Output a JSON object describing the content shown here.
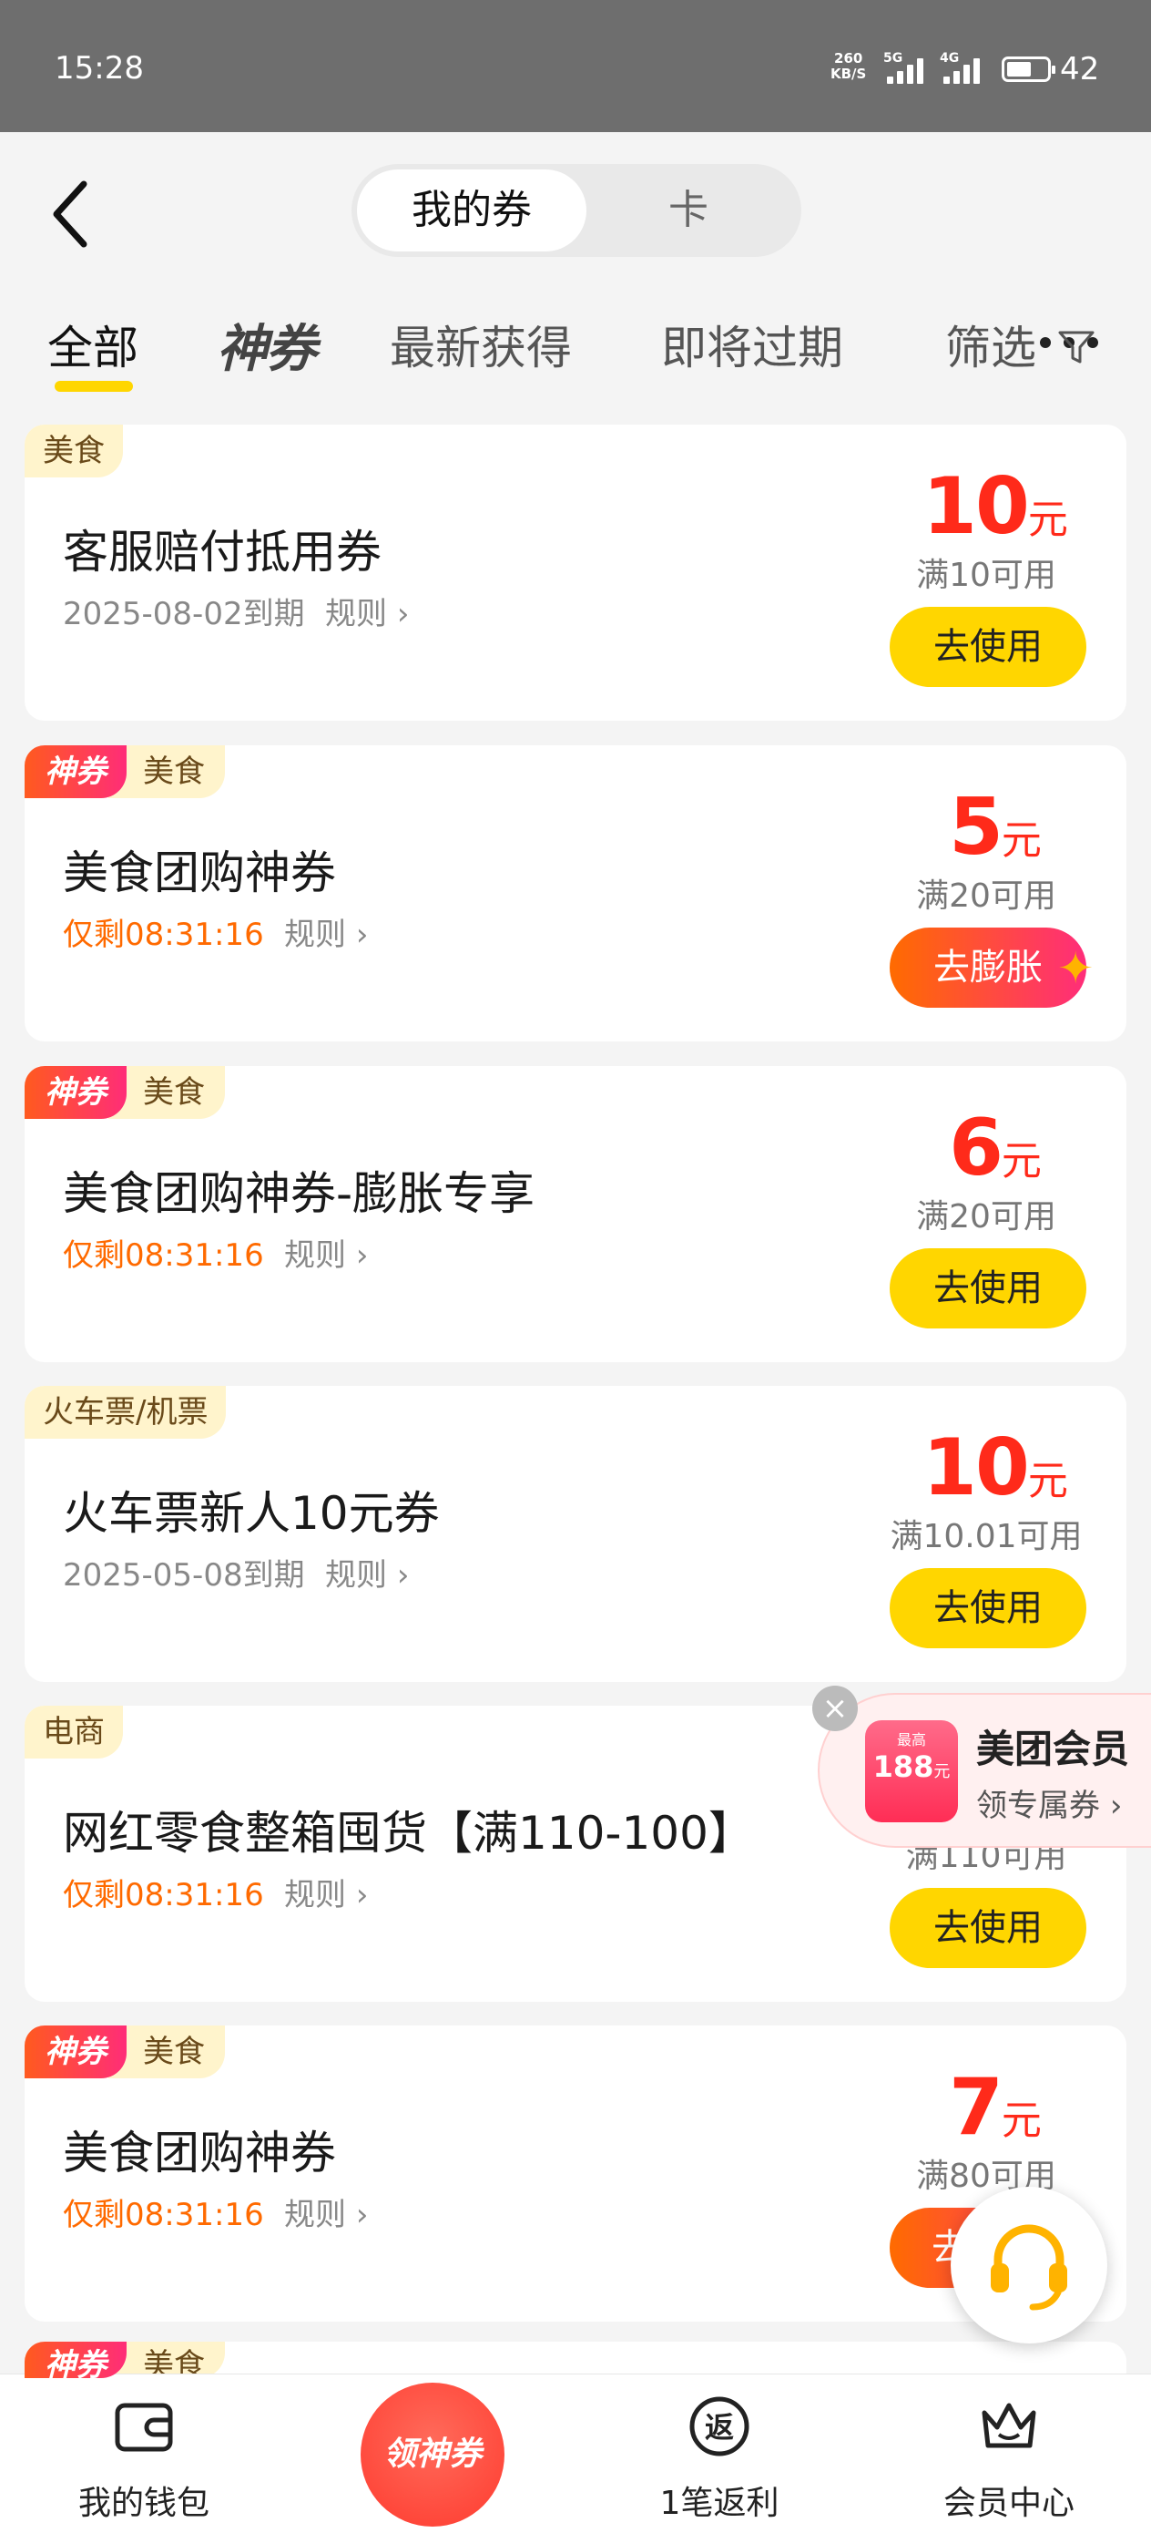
{
  "status_bar": {
    "time": "15:28",
    "net_speed_top": "260",
    "net_speed_bottom": "KB/S",
    "sig1": "5G",
    "sig2": "4G",
    "battery": "42"
  },
  "header": {
    "seg_active": "我的券",
    "seg_inactive": "卡"
  },
  "tabs": {
    "all": "全部",
    "shen": "神券",
    "newest": "最新获得",
    "expiring": "即将过期",
    "filter": "筛选"
  },
  "coupons": [
    {
      "shen": "",
      "category": "美食",
      "title": "客服赔付抵用券",
      "sub": "2025-08-02到期",
      "rule": "规则",
      "amount": "10",
      "unit": "元",
      "cond": "满10可用",
      "btn": "去使用"
    },
    {
      "shen": "神券",
      "category": "美食",
      "title": "美食团购神券",
      "sub": "仅剩08:31:16",
      "rule": "规则",
      "amount": "5",
      "unit": "元",
      "cond": "满20可用",
      "btn": "去膨胀"
    },
    {
      "shen": "神券",
      "category": "美食",
      "title": "美食团购神券-膨胀专享",
      "sub": "仅剩08:31:16",
      "rule": "规则",
      "amount": "6",
      "unit": "元",
      "cond": "满20可用",
      "btn": "去使用"
    },
    {
      "shen": "",
      "category": "火车票/机票",
      "title": "火车票新人10元券",
      "sub": "2025-05-08到期",
      "rule": "规则",
      "amount": "10",
      "unit": "元",
      "cond": "满10.01可用",
      "btn": "去使用"
    },
    {
      "shen": "",
      "category": "电商",
      "title": "网红零食整箱囤货【满110-100】",
      "sub": "仅剩08:31:16",
      "rule": "规则",
      "amount": "",
      "unit": "",
      "cond": "满110可用",
      "btn": "去使用"
    },
    {
      "shen": "神券",
      "category": "美食",
      "title": "美食团购神券",
      "sub": "仅剩08:31:16",
      "rule": "规则",
      "amount": "7",
      "unit": "元",
      "cond": "满80可用",
      "btn": "去"
    },
    {
      "shen": "神券",
      "category": "美食"
    }
  ],
  "promo": {
    "badge_top": "最高",
    "badge_amount": "188",
    "badge_unit": "元",
    "title": "美团会员",
    "sub": "领专属券"
  },
  "bottom_nav": {
    "wallet": "我的钱包",
    "center": "领神券",
    "rebate": "1笔返利",
    "member": "会员中心",
    "rebate_icon": "返"
  }
}
